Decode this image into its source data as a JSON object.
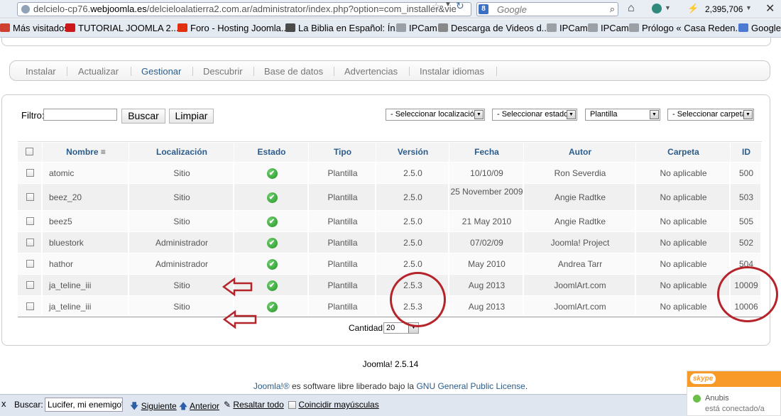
{
  "browser": {
    "url_prefix": "delcielo-cp76.",
    "url_host": "webjoomla.es",
    "url_path": "/delcieloalatierra2.com.ar/administrator/index.php?option=com_installer&vie",
    "search_placeholder": "Google",
    "search_engine_letter": "8",
    "rank_count": "2,395,706",
    "icons": [
      "globe-icon",
      "star-icon",
      "refresh-icon",
      "search-icon",
      "home-icon",
      "addon-icon",
      "close-icon"
    ]
  },
  "bookmarks": [
    {
      "label": "Más visitados",
      "color": "#d04030"
    },
    {
      "label": "TUTORIAL JOOMLA 2....",
      "color": "#cc1818"
    },
    {
      "label": "Foro - Hosting Joomla...",
      "color": "#e03010"
    },
    {
      "label": "La Biblia en Español: Ín...",
      "color": "#4a4a4a"
    },
    {
      "label": "IPCam",
      "color": "#9aa0a6"
    },
    {
      "label": "Descarga de Videos d...",
      "color": "#888888"
    },
    {
      "label": "IPCam",
      "color": "#9aa0a6"
    },
    {
      "label": "IPCam",
      "color": "#9aa0a6"
    },
    {
      "label": "Prólogo « Casa Reden...",
      "color": "#9aa0a6"
    },
    {
      "label": "Google",
      "color": "#4a7bd0"
    }
  ],
  "submenu": {
    "tabs": [
      "Instalar",
      "Actualizar",
      "Gestionar",
      "Descubrir",
      "Base de datos",
      "Advertencias",
      "Instalar idiomas"
    ],
    "active": "Gestionar"
  },
  "filters": {
    "label": "Filtro:",
    "input_value": "",
    "search_button": "Buscar",
    "clear_button": "Limpiar",
    "location_select": "- Seleccionar localización -",
    "state_select": "- Seleccionar estado -",
    "type_select": "Plantilla",
    "folder_select": "- Seleccionar carpeta -"
  },
  "table": {
    "columns": [
      "Nombre",
      "Localización",
      "Estado",
      "Tipo",
      "Versión",
      "Fecha",
      "Autor",
      "Carpeta",
      "ID"
    ],
    "rows": [
      {
        "name": "atomic",
        "location": "Sitio",
        "status": "enabled",
        "type": "Plantilla",
        "version": "2.5.0",
        "date": "10/10/09",
        "author": "Ron Severdia",
        "folder": "No aplicable",
        "id": "500"
      },
      {
        "name": "beez_20",
        "location": "Sitio",
        "status": "enabled",
        "type": "Plantilla",
        "version": "2.5.0",
        "date": "25 November 2009",
        "author": "Angie Radtke",
        "folder": "No aplicable",
        "id": "503"
      },
      {
        "name": "beez5",
        "location": "Sitio",
        "status": "enabled",
        "type": "Plantilla",
        "version": "2.5.0",
        "date": "21 May 2010",
        "author": "Angie Radtke",
        "folder": "No aplicable",
        "id": "505"
      },
      {
        "name": "bluestork",
        "location": "Administrador",
        "status": "enabled",
        "type": "Plantilla",
        "version": "2.5.0",
        "date": "07/02/09",
        "author": "Joomla! Project",
        "folder": "No aplicable",
        "id": "502"
      },
      {
        "name": "hathor",
        "location": "Administrador",
        "status": "enabled",
        "type": "Plantilla",
        "version": "2.5.0",
        "date": "May 2010",
        "author": "Andrea Tarr",
        "folder": "No aplicable",
        "id": "504"
      },
      {
        "name": "ja_teline_iii",
        "location": "Sitio",
        "status": "enabled",
        "type": "Plantilla",
        "version": "2.5.3",
        "date": "Aug 2013",
        "author": "JoomlArt.com",
        "folder": "No aplicable",
        "id": "10009"
      },
      {
        "name": "ja_teline_iii",
        "location": "Sitio",
        "status": "enabled",
        "type": "Plantilla",
        "version": "2.5.3",
        "date": "Aug 2013",
        "author": "JoomlArt.com",
        "folder": "No aplicable",
        "id": "10006"
      }
    ],
    "status_glyph": "✔"
  },
  "pagination": {
    "label": "Cantidad",
    "value": "20"
  },
  "footer": {
    "version": "Joomla! 2.5.14",
    "license_link": "Joomla!®",
    "license_text": " es software libre liberado bajo la ",
    "license_gpl": "GNU General Public License",
    "license_end": "."
  },
  "skype": {
    "logo": "skype",
    "user": "Anubis",
    "status": "está conectado/a"
  },
  "findbar": {
    "close": "x",
    "label": "Buscar:",
    "query": "Lucifer, mi enemigo\".",
    "next": "Siguiente",
    "prev": "Anterior",
    "highlight": "Resaltar todo",
    "match_case": "Coincidir mayúsculas"
  },
  "colors": {
    "annotation": "#b5242a",
    "link": "#2c5c8b",
    "status_ok": "#259325"
  }
}
